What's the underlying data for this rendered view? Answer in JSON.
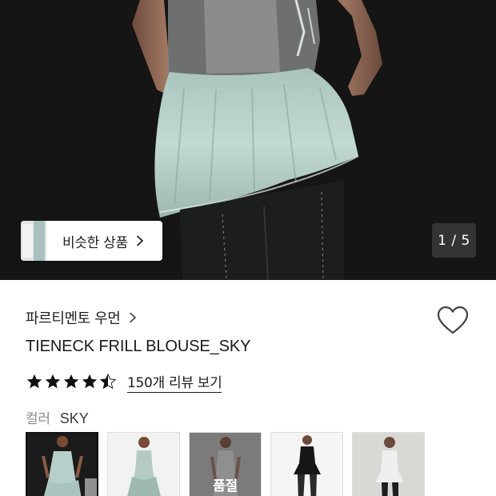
{
  "gallery": {
    "counter": "1 / 5",
    "similar_button_label": "비슷한 상품"
  },
  "product": {
    "brand": "파르티멘토 우먼",
    "name": "TIENECK FRILL BLOUSE_SKY",
    "rating": 4.5,
    "review_link": "150개 리뷰 보기",
    "color_label": "컬러",
    "color_value": "SKY"
  },
  "swatches": [
    {
      "label": "",
      "selected": true
    },
    {
      "label": "",
      "selected": false
    },
    {
      "label": "품절",
      "selected": false
    },
    {
      "label": "",
      "selected": false
    },
    {
      "label": "",
      "selected": false
    }
  ],
  "colors": {
    "blouse": "#b9d3cc",
    "star": "#111111",
    "background_dark": "#141414"
  },
  "icons": [
    "chevron-right-icon",
    "heart-icon",
    "star-icon",
    "star-half-icon"
  ]
}
